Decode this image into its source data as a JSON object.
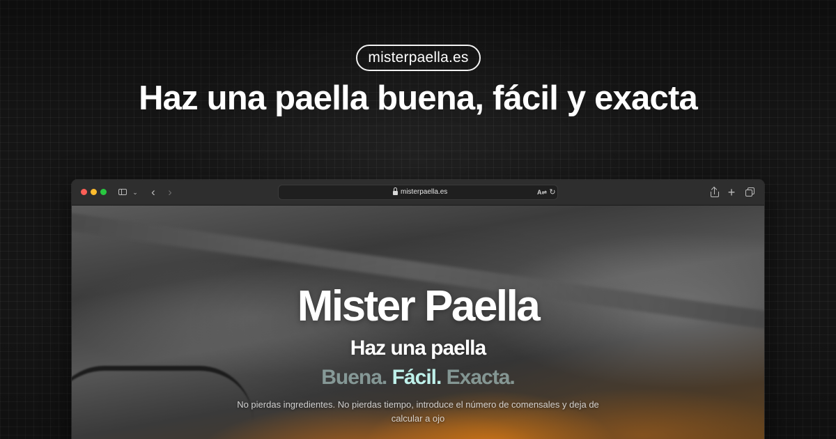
{
  "banner": {
    "domain": "misterpaella.es",
    "headline": "Haz una paella buena, fácil y exacta"
  },
  "browser": {
    "url": "misterpaella.es",
    "icons": [
      "sidebar-icon",
      "chevron-down-icon",
      "back-icon",
      "forward-icon",
      "lock-icon",
      "translate-icon",
      "reload-icon",
      "share-icon",
      "plus-icon",
      "tabs-icon"
    ],
    "traffic_lights": {
      "close": "#fe5f57",
      "minimize": "#febc2e",
      "zoom": "#28c840"
    }
  },
  "hero": {
    "title": "Mister Paella",
    "subtitle": "Haz una paella",
    "words": [
      "Buena.",
      "Fácil.",
      "Exacta."
    ],
    "description": "No pierdas ingredientes. No pierdas tiempo, introduce el número de comensales y deja de calcular a ojo"
  },
  "colors": {
    "background": "#151515",
    "text": "#ffffff",
    "accent_word": "#bff1ea"
  }
}
